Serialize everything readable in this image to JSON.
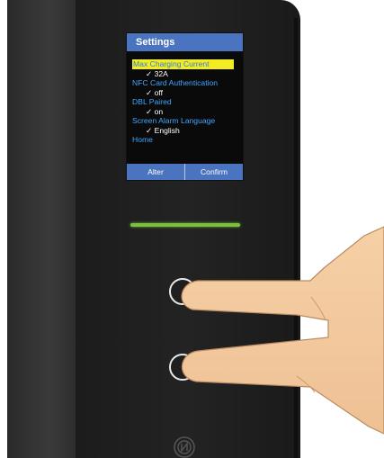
{
  "screen": {
    "title": "Settings",
    "items": [
      {
        "label": "Max Charging Current",
        "value": "✓ 32A",
        "selected": true
      },
      {
        "label": "NFC Card Authentication",
        "value": "✓ off",
        "selected": false
      },
      {
        "label": "DBL Paired",
        "value": "✓ on",
        "selected": false
      },
      {
        "label": "Screen Alarm Language",
        "value": "✓ English",
        "selected": false
      },
      {
        "label": "Home",
        "value": null,
        "selected": false
      }
    ],
    "footer": {
      "alter_label": "Alter",
      "confirm_label": "Confirm"
    }
  },
  "colors": {
    "title_bar": "#4a74bf",
    "highlight": "#f3ec23",
    "menu_text": "#3fa6ff",
    "led": "#7dbf3f",
    "device_body": "#1f1f1f"
  },
  "icons": {
    "touch_button_upper": "circle-button-icon",
    "touch_button_lower": "circle-button-icon",
    "nfc_reader": "nfc-icon"
  }
}
